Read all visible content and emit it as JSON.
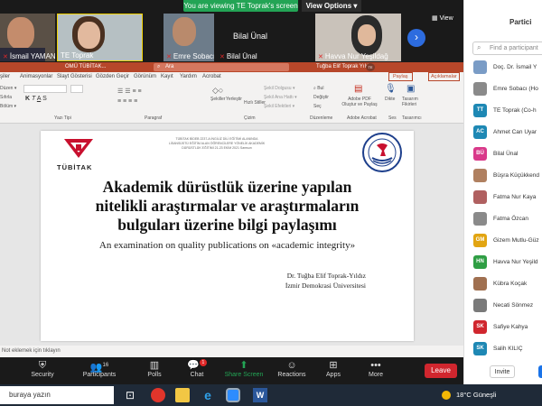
{
  "zoom": {
    "banner": "You are viewing TE Toprak's screen",
    "view_options": "View Options",
    "gallery_view": "View",
    "participants_count": "16",
    "participants_in_gallery": [
      {
        "name": "İsmail YAMAN (..."
      },
      {
        "name": "TE Toprak"
      },
      {
        "name": "Emre Sobacı"
      },
      {
        "name": "Bilal Ünal"
      },
      {
        "name": "Havva Nur Yeşildağ"
      }
    ],
    "controls": {
      "security": "Security",
      "participants": "Participants",
      "polls": "Polls",
      "chat": "Chat",
      "chat_badge": "1",
      "share_screen": "Share Screen",
      "reactions": "Reactions",
      "apps": "Apps",
      "more": "More",
      "leave": "Leave"
    }
  },
  "powerpoint": {
    "window_left": "OMÜ TÜBİTAK...",
    "search": "Ara",
    "user": "Tuğba Elif Toprak Yıldız",
    "user_initials": "TE",
    "share_label": "Paylaş",
    "comments_label": "Açıklamalar",
    "menus": [
      "şiler",
      "Animasyonlar",
      "Slayt Gösterisi",
      "Gözden Geçir",
      "Görünüm",
      "Kayıt",
      "Yardım",
      "Acrobat"
    ],
    "ribbon_groups": [
      "Yazı Tipi",
      "Paragraf",
      "Çizim",
      "Düzenleme",
      "Adobe Acrobat",
      "Ses",
      "Tasarımcı"
    ],
    "ribbon_buttons": {
      "shapes": "Şekiller",
      "arrange": "Yerleştir",
      "quick_styles": "Hızlı Stiller",
      "find": "Bul",
      "replace": "Değiştir",
      "select": "Seç",
      "adobe": "Adobe PDF Oluştur ve Paylaş",
      "dictate": "Dikte",
      "designer": "Tasarım Fikirleri"
    },
    "status_bar": "Not eklemek için tıklayın"
  },
  "slide": {
    "logo_text": "TÜBİTAK",
    "header_line1": "TÜBİTAK BİDEB 2237-A İNGİLİZ DİLİ EĞİTİMİ ALANINDA",
    "header_line2": "LİSANSÜSTÜ EĞİTİM ALAN ÖĞRENCİLERE YÖNELİK AKADEMİK",
    "header_line3": "DÜRÜSTLÜK EĞİTİMİ 21-23 EKİM 2021 Samsun",
    "title": "Akademik dürüstlük üzerine yapılan nitelikli araştırmalar ve araştırmaların bulguları üzerine bilgi paylaşımı",
    "subtitle": "An examination on quality publications on «academic integrity»",
    "author": "Dr. Tuğba Elif Toprak-Yıldız",
    "affiliation": "İzmir Demokrasi Üniversitesi"
  },
  "panel": {
    "title": "Partici",
    "search_placeholder": "Find a participant",
    "participants": [
      {
        "name": "Doç. Dr. İsmail Y",
        "initials": "",
        "color": "#7a9cc6"
      },
      {
        "name": "Emre Sobacı (Ho",
        "initials": "",
        "color": "#8a8a8a"
      },
      {
        "name": "TE Toprak (Co-h",
        "initials": "TT",
        "color": "#1e88b4"
      },
      {
        "name": "Ahmet Can Uyar",
        "initials": "AC",
        "color": "#1e88b4"
      },
      {
        "name": "Bilal Ünal",
        "initials": "BÜ",
        "color": "#d9398a"
      },
      {
        "name": "Büşra Küçükkend",
        "initials": "",
        "color": "#b08060"
      },
      {
        "name": "Fatma Nur Kaya",
        "initials": "",
        "color": "#b06060"
      },
      {
        "name": "Fatma Özcan",
        "initials": "",
        "color": "#8a8a8a"
      },
      {
        "name": "Gizem Mutlu-Güz",
        "initials": "GM",
        "color": "#e2a512"
      },
      {
        "name": "Havva Nur Yeşild",
        "initials": "HN",
        "color": "#2f9e44"
      },
      {
        "name": "Kübra Koçak",
        "initials": "",
        "color": "#a07050"
      },
      {
        "name": "Necati Sönmez",
        "initials": "",
        "color": "#7a7a7a"
      },
      {
        "name": "Safiye Kahya",
        "initials": "SK",
        "color": "#d0262e"
      },
      {
        "name": "Salih KILIÇ",
        "initials": "SK",
        "color": "#1e88b4"
      }
    ],
    "invite": "Invite"
  },
  "taskbar": {
    "search": "buraya yazın",
    "temperature": "18°C",
    "weather": "Güneşli"
  }
}
